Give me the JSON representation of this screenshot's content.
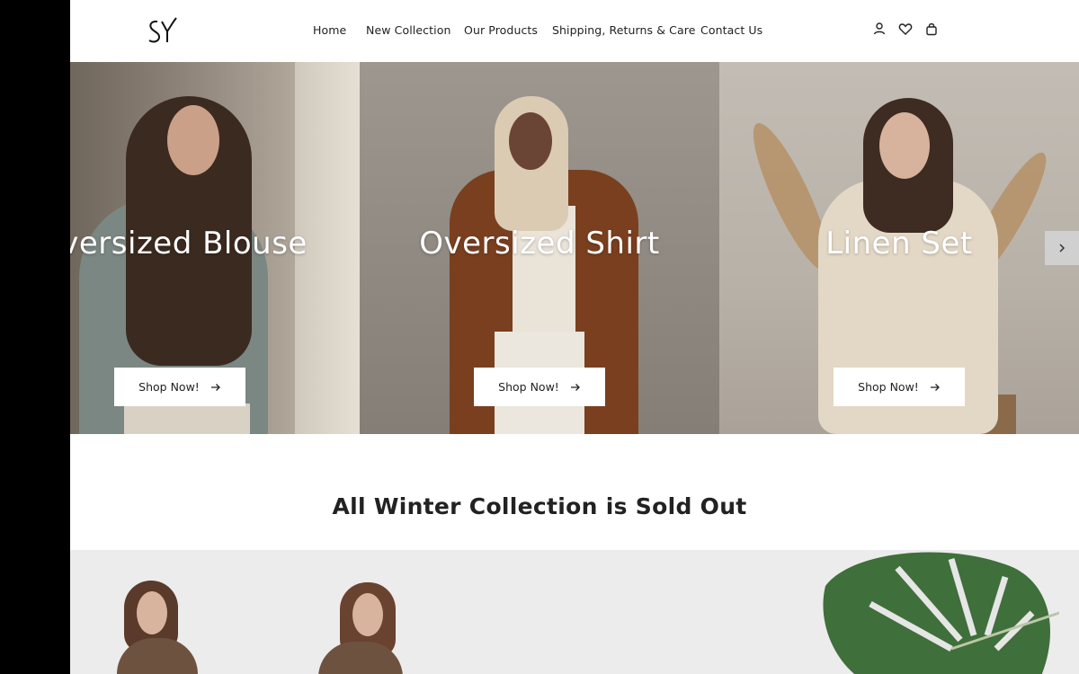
{
  "header": {
    "logo_text": "SY",
    "nav": [
      "Home",
      "New Collection",
      "Our Products",
      "Shipping, Returns & Care",
      "Contact Us"
    ],
    "icons": [
      "user-icon",
      "heart-icon",
      "bag-icon"
    ]
  },
  "hero": {
    "slides": [
      {
        "title": "Oversized Blouse",
        "button": "Shop Now!"
      },
      {
        "title": "Oversized Shirt",
        "button": "Shop Now!"
      },
      {
        "title": "Linen Set",
        "button": "Shop Now!"
      }
    ],
    "next_icon": "chevron-right-icon"
  },
  "section": {
    "title": "All Winter Collection is Sold Out"
  },
  "colors": {
    "background": "#ffffff",
    "text": "#222222",
    "banner": "#ececec"
  }
}
